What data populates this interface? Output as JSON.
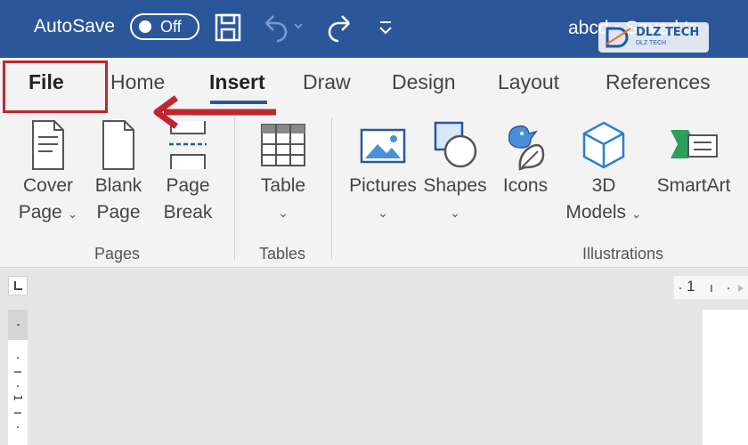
{
  "title_bar": {
    "autosave_label": "AutoSave",
    "autosave_state": "Off",
    "document_title": "abcd • Saved to",
    "watermark_text": "DLZ TECH",
    "watermark_subtext": "DLZ TECH"
  },
  "tabs": [
    {
      "label": "File"
    },
    {
      "label": "Home"
    },
    {
      "label": "Insert"
    },
    {
      "label": "Draw"
    },
    {
      "label": "Design"
    },
    {
      "label": "Layout"
    },
    {
      "label": "References"
    }
  ],
  "active_tab": "Insert",
  "ribbon": {
    "pages": {
      "group_label": "Pages",
      "cover_page": [
        "Cover",
        "Page"
      ],
      "blank_page": [
        "Blank",
        "Page"
      ],
      "page_break": [
        "Page",
        "Break"
      ]
    },
    "tables": {
      "group_label": "Tables",
      "table": "Table"
    },
    "illustrations": {
      "group_label": "Illustrations",
      "pictures": "Pictures",
      "shapes": "Shapes",
      "icons": "Icons",
      "models_3d": [
        "3D",
        "Models"
      ],
      "smartart": "SmartArt"
    }
  },
  "ruler": {
    "mark": "1"
  },
  "colors": {
    "title_bar": "#2b579a",
    "highlight": "#c0272d"
  },
  "icons": [
    "save-icon",
    "undo-icon",
    "redo-icon",
    "customize-qat-icon",
    "arrow-annotation"
  ]
}
